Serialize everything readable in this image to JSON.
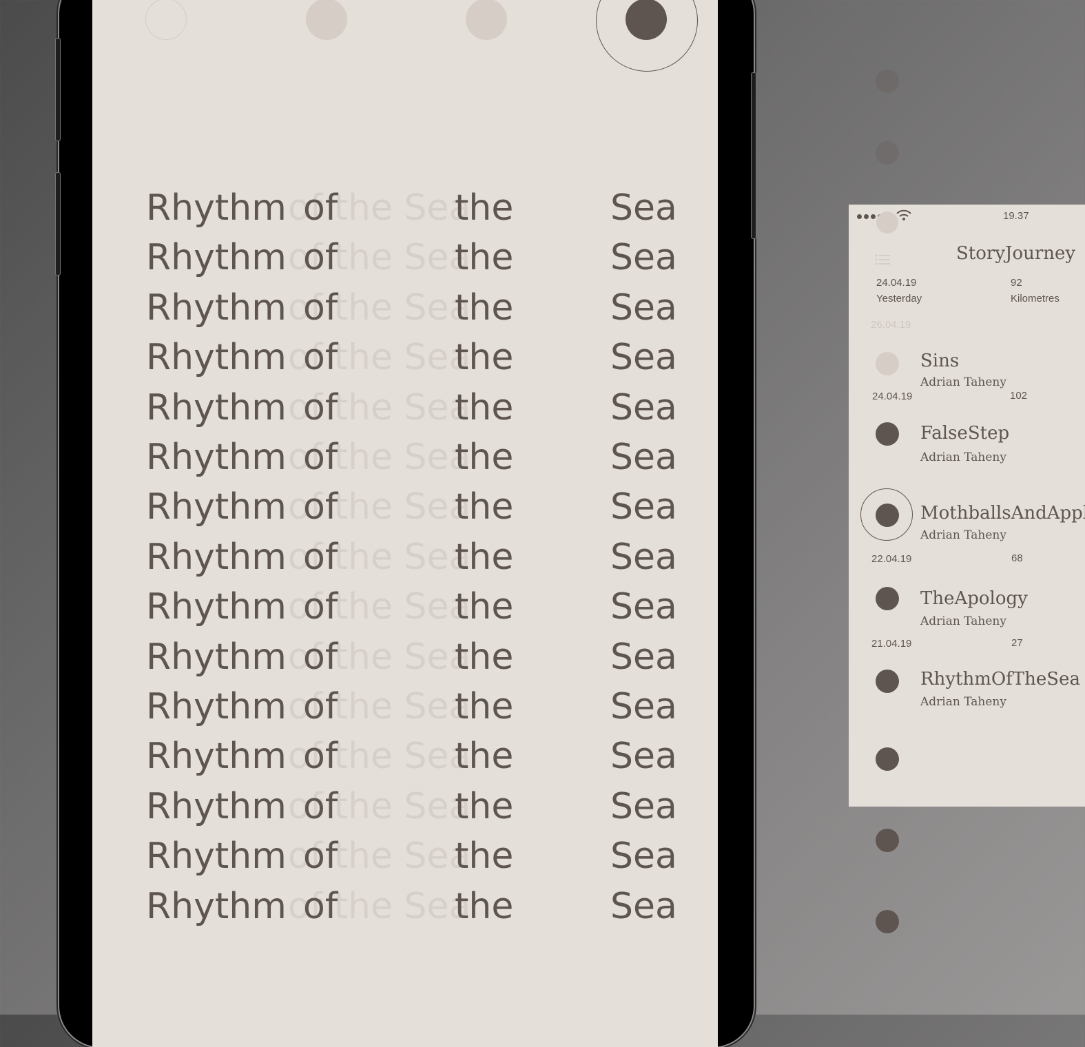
{
  "lyrics": {
    "rows": [
      {
        "w1": "Rhythm",
        "w2": "of",
        "ghost": "of the Sea",
        "w3": "the",
        "w4": "Sea"
      },
      {
        "w1": "Rhythm",
        "w2": "of",
        "ghost": "of the Sea",
        "w3": "the",
        "w4": "Sea"
      },
      {
        "w1": "Rhythm",
        "w2": "of",
        "ghost": "of the Sea",
        "w3": "the",
        "w4": "Sea"
      },
      {
        "w1": "Rhythm",
        "w2": "of",
        "ghost": "of the Sea",
        "w3": "the",
        "w4": "Sea"
      },
      {
        "w1": "Rhythm",
        "w2": "of",
        "ghost": "of the Sea",
        "w3": "the",
        "w4": "Sea"
      },
      {
        "w1": "Rhythm",
        "w2": "of",
        "ghost": "of the Sea",
        "w3": "the",
        "w4": "Sea"
      },
      {
        "w1": "Rhythm",
        "w2": "of",
        "ghost": "of the Sea",
        "w3": "the",
        "w4": "Sea"
      },
      {
        "w1": "Rhythm",
        "w2": "of",
        "ghost": "of the Sea",
        "w3": "the",
        "w4": "Sea"
      },
      {
        "w1": "Rhythm",
        "w2": "of",
        "ghost": "of the Sea",
        "w3": "the",
        "w4": "Sea"
      },
      {
        "w1": "Rhythm",
        "w2": "of",
        "ghost": "of the Sea",
        "w3": "the",
        "w4": "Sea"
      },
      {
        "w1": "Rhythm",
        "w2": "of",
        "ghost": "of the Sea",
        "w3": "the",
        "w4": "Sea"
      },
      {
        "w1": "Rhythm",
        "w2": "of",
        "ghost": "of the Sea",
        "w3": "the",
        "w4": "Sea"
      },
      {
        "w1": "Rhythm",
        "w2": "of",
        "ghost": "of the Sea",
        "w3": "the",
        "w4": "Sea"
      },
      {
        "w1": "Rhythm",
        "w2": "of",
        "ghost": "of the Sea",
        "w3": "the",
        "w4": "Sea"
      },
      {
        "w1": "Rhythm",
        "w2": "of",
        "ghost": "of the Sea",
        "w3": "the",
        "w4": "Sea"
      }
    ]
  },
  "card": {
    "time": "19.37",
    "title": "StoryJourney",
    "summary": {
      "date": "24.04.19",
      "date_label": "Yesterday",
      "distance": "92",
      "distance_label": "Kilometres"
    },
    "faded_date": "26.04.19",
    "entries": [
      {
        "story": "Sins",
        "author": "Adrian Taheny",
        "date": "24.04.19",
        "distance": "102"
      },
      {
        "story": "FalseStep",
        "author": "Adrian Taheny"
      },
      {
        "story": "MothballsAndApples",
        "author": "Adrian Taheny",
        "date": "22.04.19",
        "distance": "68"
      },
      {
        "story": "TheApology",
        "author": "Adrian Taheny",
        "date": "21.04.19",
        "distance": "27"
      },
      {
        "story": "RhythmOfTheSea",
        "author": "Adrian Taheny"
      }
    ]
  },
  "colors": {
    "ink": "#5e5551",
    "paper": "#e5dfd9",
    "ghost": "#d7d0ca"
  },
  "icons": [
    "signal-dots-icon",
    "wifi-icon",
    "list-menu-icon"
  ]
}
